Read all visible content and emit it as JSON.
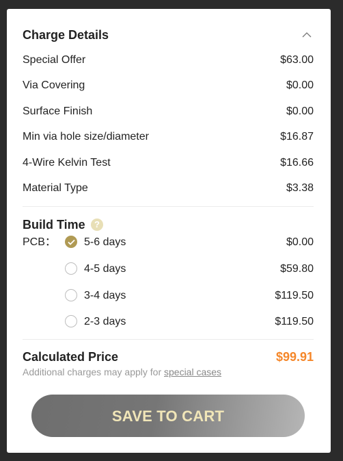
{
  "charge_details": {
    "title": "Charge Details",
    "items": [
      {
        "label": "Special Offer",
        "value": "$63.00"
      },
      {
        "label": "Via Covering",
        "value": "$0.00"
      },
      {
        "label": "Surface Finish",
        "value": "$0.00"
      },
      {
        "label": "Min via hole size/diameter",
        "value": "$16.87"
      },
      {
        "label": "4-Wire Kelvin Test",
        "value": "$16.66"
      },
      {
        "label": "Material Type",
        "value": "$3.38"
      }
    ]
  },
  "build_time": {
    "title": "Build Time",
    "help_glyph": "?",
    "pcb_label": "PCB：",
    "options": [
      {
        "label": "5-6 days",
        "price": "$0.00",
        "selected": true
      },
      {
        "label": "4-5 days",
        "price": "$59.80",
        "selected": false
      },
      {
        "label": "3-4 days",
        "price": "$119.50",
        "selected": false
      },
      {
        "label": "2-3 days",
        "price": "$119.50",
        "selected": false
      }
    ]
  },
  "calculated": {
    "title": "Calculated Price",
    "price": "$99.91",
    "note_prefix": "Additional charges may apply for ",
    "note_link": "special cases"
  },
  "cart": {
    "label": "SAVE TO CART"
  },
  "colors": {
    "accent_gold": "#b09a54",
    "price_orange": "#f5872a",
    "button_text": "#f1e6b8"
  }
}
